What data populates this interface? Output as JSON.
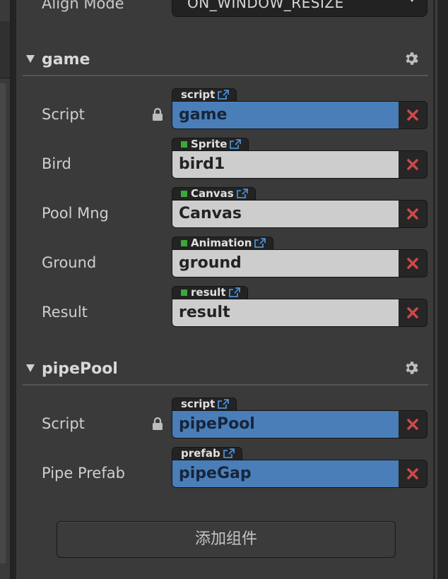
{
  "align": {
    "label": "Align Mode",
    "value": "ON_WINDOW_RESIZE"
  },
  "sections": [
    {
      "title": "game",
      "props": [
        {
          "label": "Script",
          "tag": "script",
          "value": "game"
        },
        {
          "label": "Bird",
          "tag": "Sprite",
          "value": "bird1"
        },
        {
          "label": "Pool Mng",
          "tag": "Canvas",
          "value": "Canvas"
        },
        {
          "label": "Ground",
          "tag": "Animation",
          "value": "ground"
        },
        {
          "label": "Result",
          "tag": "result",
          "value": "result"
        }
      ]
    },
    {
      "title": "pipePool",
      "props": [
        {
          "label": "Script",
          "tag": "script",
          "value": "pipePool"
        },
        {
          "label": "Pipe Prefab",
          "tag": "prefab",
          "value": "pipeGap"
        }
      ]
    }
  ],
  "add_component_label": "添加组件",
  "colors": {
    "asset_field": "#4a7eb8",
    "node_field": "#cdcdcd",
    "node_indicator": "#3aa83a",
    "clear_icon": "#d04848"
  }
}
